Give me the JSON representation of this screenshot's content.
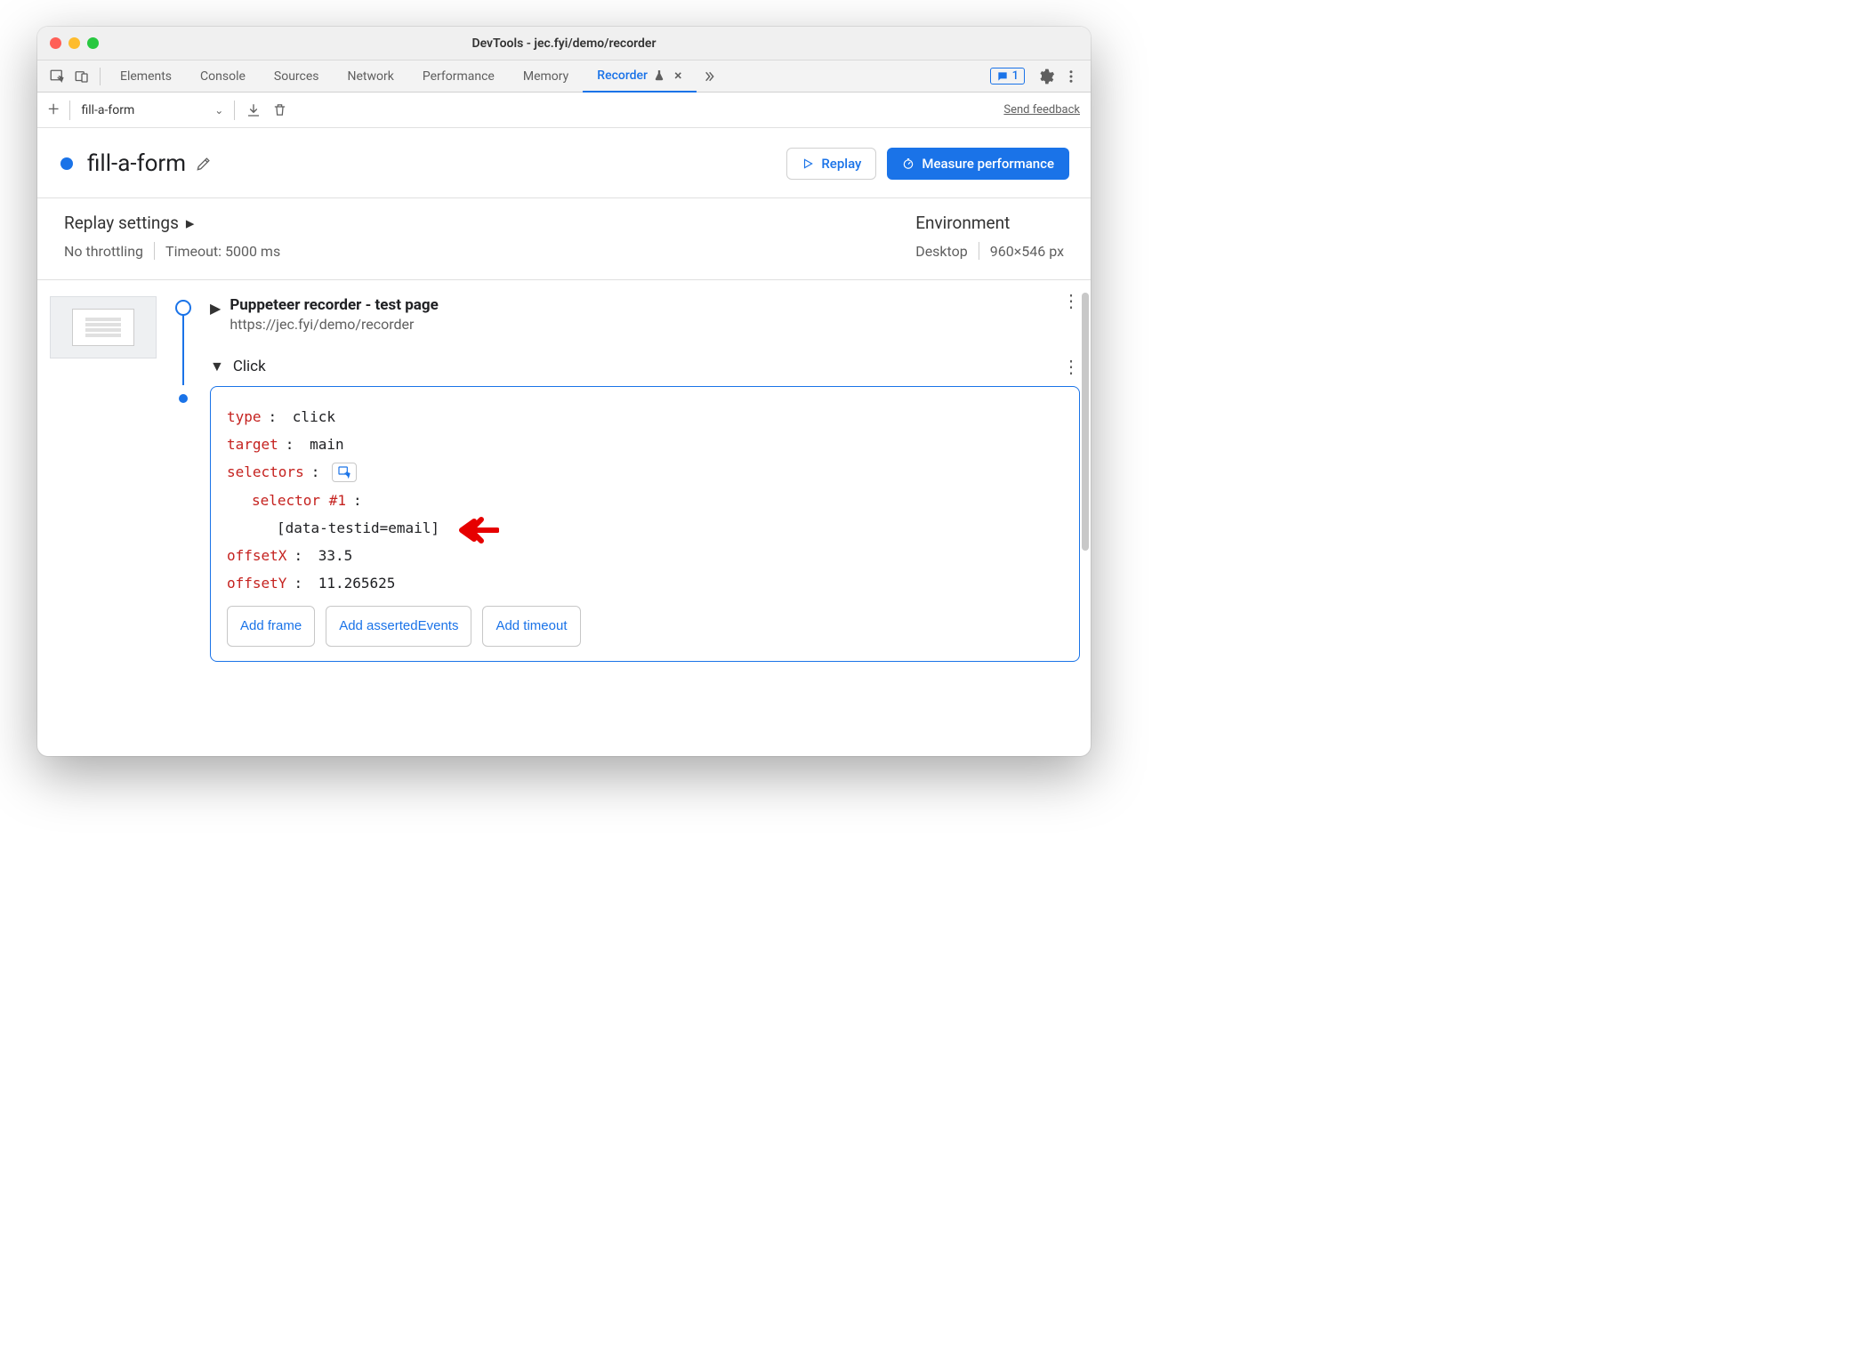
{
  "window": {
    "title": "DevTools - jec.fyi/demo/recorder"
  },
  "tabs": {
    "items": [
      "Elements",
      "Console",
      "Sources",
      "Network",
      "Performance",
      "Memory",
      "Recorder"
    ],
    "active": "Recorder",
    "badge_count": "1"
  },
  "toolbar": {
    "recording_name": "fill-a-form",
    "feedback": "Send feedback"
  },
  "header": {
    "title": "fill-a-form",
    "replay": "Replay",
    "measure": "Measure performance"
  },
  "settings": {
    "replay_label": "Replay settings",
    "throttling": "No throttling",
    "timeout": "Timeout: 5000 ms",
    "env_label": "Environment",
    "device": "Desktop",
    "viewport": "960×546 px"
  },
  "steps": {
    "step1": {
      "title": "Puppeteer recorder - test page",
      "url": "https://jec.fyi/demo/recorder"
    },
    "step2": {
      "label": "Click"
    },
    "edit": {
      "type_k": "type",
      "type_v": "click",
      "target_k": "target",
      "target_v": "main",
      "selectors_k": "selectors",
      "sel1_label": "selector #1",
      "sel1_value": "[data-testid=email]",
      "offsetx_k": "offsetX",
      "offsetx_v": "33.5",
      "offsety_k": "offsetY",
      "offsety_v": "11.265625",
      "add_frame": "Add frame",
      "add_asserted": "Add assertedEvents",
      "add_timeout": "Add timeout"
    }
  }
}
